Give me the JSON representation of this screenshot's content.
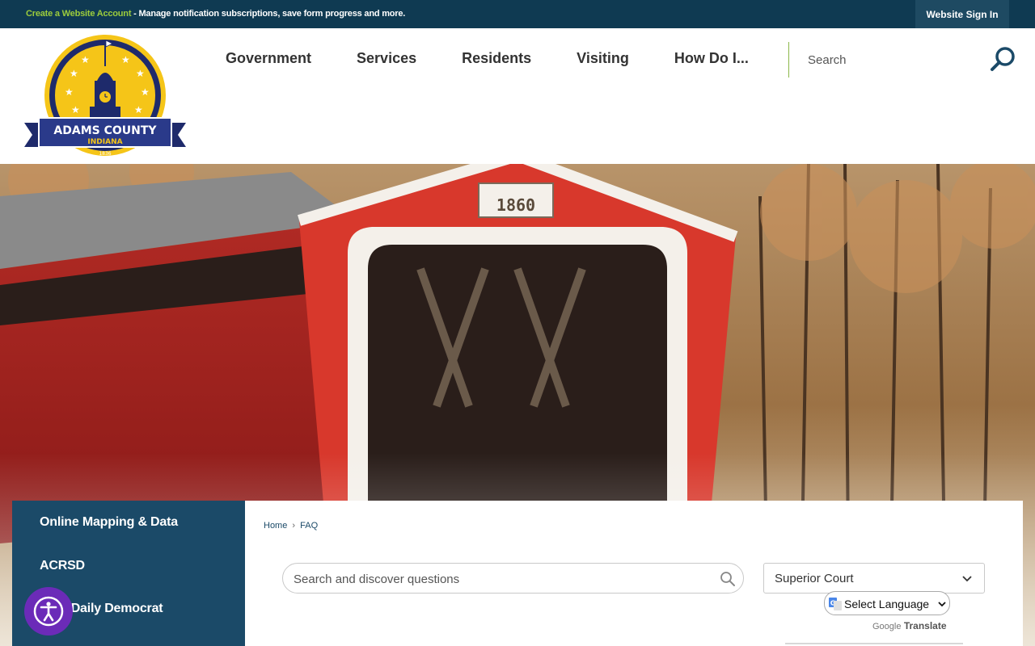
{
  "topbar": {
    "create_account": "Create a Website Account",
    "notice_text": " - Manage notification subscriptions, save form progress and more.",
    "sign_in": "Website Sign In"
  },
  "logo": {
    "name": "ADAMS COUNTY",
    "state": "INDIANA",
    "year": "1836"
  },
  "nav": {
    "items": [
      "Government",
      "Services",
      "Residents",
      "Visiting",
      "How Do I..."
    ]
  },
  "search": {
    "placeholder": "Search"
  },
  "hero": {
    "sign_year": "1860"
  },
  "sidebar": {
    "items": [
      "Online Mapping & Data",
      "ACRSD",
      "Your Daily Democrat"
    ]
  },
  "breadcrumb": {
    "home": "Home",
    "separator": "›",
    "current": "FAQ"
  },
  "faq": {
    "search_placeholder": "Search and discover questions",
    "category_selected": "Superior Court"
  },
  "translate": {
    "label": "Select Language",
    "powered_by": "Google",
    "translate_word": "Translate"
  },
  "colors": {
    "topbar": "#0f3a52",
    "create_link": "#9ccc3c",
    "sidebar": "#1b4a68",
    "accent_green": "#8cb84a",
    "accessibility": "#6b2bb8"
  },
  "icons": {
    "search": "magnifier-icon",
    "chevron": "chevron-down-icon",
    "accessibility": "accessibility-icon",
    "google": "google-g-icon"
  }
}
